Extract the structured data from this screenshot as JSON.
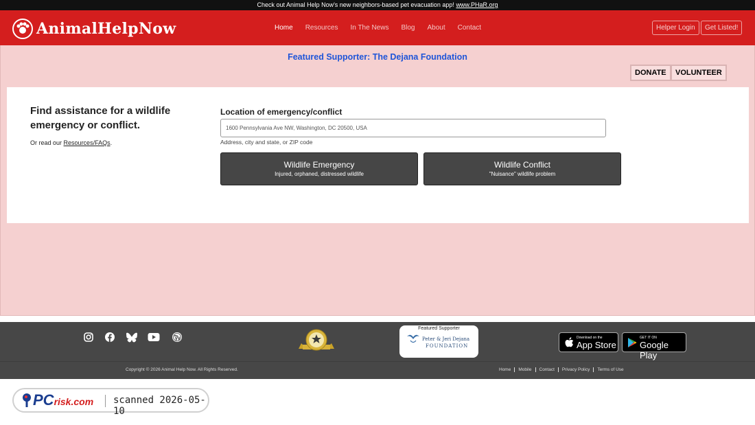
{
  "announcement": {
    "text": "Check out Animal Help Now's new neighbors-based pet evacuation app!",
    "link": "www.PHaR.org"
  },
  "header": {
    "logo_text": "AnimalHelpNow",
    "nav": [
      "Home",
      "Resources",
      "In The News",
      "Blog",
      "About",
      "Contact"
    ],
    "helper_login": "Helper Login",
    "get_listed": "Get Listed!"
  },
  "featured": "Featured Supporter: The Dejana Foundation",
  "actions": {
    "donate": "DONATE",
    "volunteer": "VOLUNTEER"
  },
  "card": {
    "title": "Find assistance for a wildlife emergency or conflict.",
    "sub_prefix": "Or read our",
    "sub_link": "Resources/FAQs",
    "sub_suffix": ".",
    "location_label": "Location of emergency/conflict",
    "location_placeholder": "1600 Pennsylvania Ave NW, Washington, DC 20500, USA",
    "location_hint": "Address, city and state, or ZIP code",
    "emergency_title": "Wildlife Emergency",
    "emergency_sub": "Injured, orphaned, distressed wildlife",
    "conflict_title": "Wildlife Conflict",
    "conflict_sub": "\"Nuisance\" wildlife problem"
  },
  "footer": {
    "social_icons": [
      "instagram-icon",
      "facebook-icon",
      "bluesky-icon",
      "youtube-icon",
      "wordpress-icon"
    ],
    "dejana_caption": "Featured Supporter",
    "dejana_name": "Peter & Jeri Dejana",
    "dejana_foundation": "FOUNDATION",
    "app_store_small": "Download on the",
    "app_store_big": "App Store",
    "play_small": "GET IT ON",
    "play_big": "Google Play",
    "copyright": "Copyright © 2026 Animal Help Now. All Rights Reserved.",
    "links": [
      "Home",
      "Mobile",
      "Contact",
      "Privacy Policy",
      "Terms of Use"
    ]
  },
  "watermark": {
    "brand": "PC",
    "brand_suffix": "risk.com",
    "scan_text": "scanned 2026-05-10"
  }
}
